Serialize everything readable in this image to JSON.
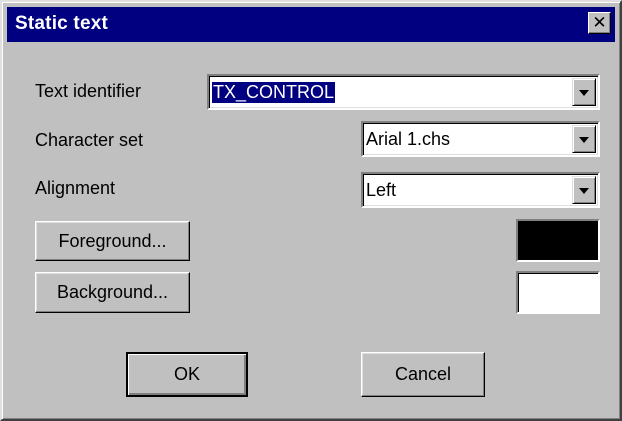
{
  "dialog": {
    "title": "Static text",
    "close_glyph": "✕"
  },
  "fields": {
    "text_identifier": {
      "label": "Text identifier",
      "value": "TX_CONTROL"
    },
    "character_set": {
      "label": "Character set",
      "value": "Arial 1.chs"
    },
    "alignment": {
      "label": "Alignment",
      "value": "Left"
    }
  },
  "buttons": {
    "foreground": "Foreground...",
    "background": "Background...",
    "ok": "OK",
    "cancel": "Cancel"
  },
  "colors": {
    "titlebar": "#000080",
    "face": "#c0c0c0",
    "foreground_swatch": "#000000",
    "background_swatch": "#ffffff"
  },
  "icons": {
    "close": "close-icon",
    "dropdown": "chevron-down-icon"
  }
}
